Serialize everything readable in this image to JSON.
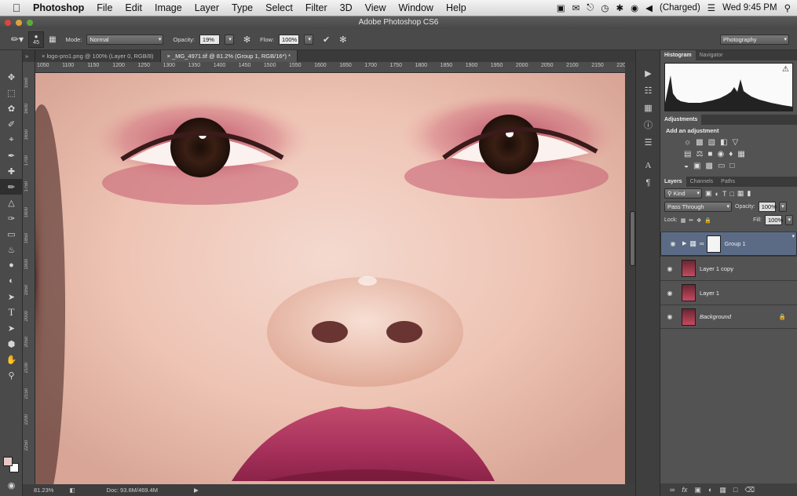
{
  "menubar": {
    "app_name": "Photoshop",
    "items": [
      "File",
      "Edit",
      "Image",
      "Layer",
      "Type",
      "Select",
      "Filter",
      "3D",
      "View",
      "Window",
      "Help"
    ],
    "battery": "(Charged)",
    "clock": "Wed 9:45 PM"
  },
  "window": {
    "title": "Adobe Photoshop CS6"
  },
  "options": {
    "brush_size": "45",
    "mode_label": "Mode:",
    "mode_value": "Normal",
    "opacity_label": "Opacity:",
    "opacity_value": "19%",
    "flow_label": "Flow:",
    "flow_value": "100%",
    "workspace": "Photography"
  },
  "tabs": [
    {
      "label": "logo-pro1.png @ 100% (Layer 0, RGB/8)"
    },
    {
      "label": "_MG_4971.tif @ 81.2% (Group 1, RGB/16*) *"
    }
  ],
  "ruler": {
    "h_ticks": [
      "1050",
      "1100",
      "1150",
      "1200",
      "1250",
      "1300",
      "1350",
      "1400",
      "1450",
      "1500",
      "1550",
      "1600",
      "1650",
      "1700",
      "1750",
      "1800",
      "1850",
      "1900",
      "1950",
      "2000",
      "2050",
      "2100",
      "2150",
      "2200"
    ],
    "v_ticks": [
      "1550",
      "1600",
      "1650",
      "1700",
      "1750",
      "1800",
      "1850",
      "1900",
      "1950",
      "2000",
      "2050",
      "2100",
      "2150",
      "2200",
      "2250"
    ]
  },
  "status": {
    "zoom": "81.23%",
    "doc": "Doc: 93.6M/469.4M"
  },
  "panels": {
    "histogram_tabs": [
      "Histogram",
      "Navigator"
    ],
    "adjustments_tab": "Adjustments",
    "adjustments_label": "Add an adjustment",
    "layers_tabs": [
      "Layers",
      "Channels",
      "Paths"
    ],
    "kind": "Kind",
    "blend_mode": "Pass Through",
    "opacity_label": "Opacity:",
    "opacity": "100%",
    "lock_label": "Lock:",
    "fill_label": "Fill:",
    "fill": "100%",
    "layers": [
      {
        "name": "Group 1"
      },
      {
        "name": "Layer 1 copy"
      },
      {
        "name": "Layer 1"
      },
      {
        "name": "Background"
      }
    ]
  },
  "colors": {
    "accent": "#5b6b86",
    "skin": "#ecc2b2",
    "lip": "#b8385f"
  }
}
